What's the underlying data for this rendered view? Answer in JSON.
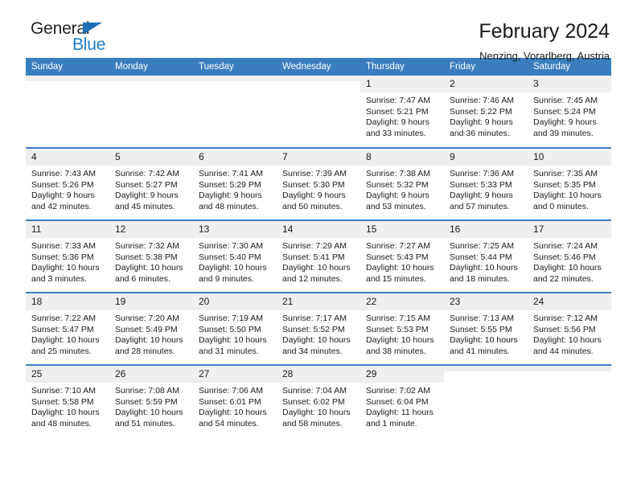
{
  "brand": {
    "word_top": "General",
    "word_bottom": "Blue",
    "triangle_color": "#1f6eb5",
    "blue_color": "#1f7bc4"
  },
  "header": {
    "title": "February 2024",
    "subtitle": "Nenzing, Vorarlberg, Austria"
  },
  "theme": {
    "header_bg": "#3a7ebf",
    "daynum_bg": "#efefef",
    "text": "#1a1a1a"
  },
  "weekday_headers": [
    "Sunday",
    "Monday",
    "Tuesday",
    "Wednesday",
    "Thursday",
    "Friday",
    "Saturday"
  ],
  "weeks": [
    [
      {
        "day": "",
        "lines": []
      },
      {
        "day": "",
        "lines": []
      },
      {
        "day": "",
        "lines": []
      },
      {
        "day": "",
        "lines": []
      },
      {
        "day": "1",
        "lines": [
          "Sunrise: 7:47 AM",
          "Sunset: 5:21 PM",
          "Daylight: 9 hours",
          "and 33 minutes."
        ]
      },
      {
        "day": "2",
        "lines": [
          "Sunrise: 7:46 AM",
          "Sunset: 5:22 PM",
          "Daylight: 9 hours",
          "and 36 minutes."
        ]
      },
      {
        "day": "3",
        "lines": [
          "Sunrise: 7:45 AM",
          "Sunset: 5:24 PM",
          "Daylight: 9 hours",
          "and 39 minutes."
        ]
      }
    ],
    [
      {
        "day": "4",
        "lines": [
          "Sunrise: 7:43 AM",
          "Sunset: 5:26 PM",
          "Daylight: 9 hours",
          "and 42 minutes."
        ]
      },
      {
        "day": "5",
        "lines": [
          "Sunrise: 7:42 AM",
          "Sunset: 5:27 PM",
          "Daylight: 9 hours",
          "and 45 minutes."
        ]
      },
      {
        "day": "6",
        "lines": [
          "Sunrise: 7:41 AM",
          "Sunset: 5:29 PM",
          "Daylight: 9 hours",
          "and 48 minutes."
        ]
      },
      {
        "day": "7",
        "lines": [
          "Sunrise: 7:39 AM",
          "Sunset: 5:30 PM",
          "Daylight: 9 hours",
          "and 50 minutes."
        ]
      },
      {
        "day": "8",
        "lines": [
          "Sunrise: 7:38 AM",
          "Sunset: 5:32 PM",
          "Daylight: 9 hours",
          "and 53 minutes."
        ]
      },
      {
        "day": "9",
        "lines": [
          "Sunrise: 7:36 AM",
          "Sunset: 5:33 PM",
          "Daylight: 9 hours",
          "and 57 minutes."
        ]
      },
      {
        "day": "10",
        "lines": [
          "Sunrise: 7:35 AM",
          "Sunset: 5:35 PM",
          "Daylight: 10 hours",
          "and 0 minutes."
        ]
      }
    ],
    [
      {
        "day": "11",
        "lines": [
          "Sunrise: 7:33 AM",
          "Sunset: 5:36 PM",
          "Daylight: 10 hours",
          "and 3 minutes."
        ]
      },
      {
        "day": "12",
        "lines": [
          "Sunrise: 7:32 AM",
          "Sunset: 5:38 PM",
          "Daylight: 10 hours",
          "and 6 minutes."
        ]
      },
      {
        "day": "13",
        "lines": [
          "Sunrise: 7:30 AM",
          "Sunset: 5:40 PM",
          "Daylight: 10 hours",
          "and 9 minutes."
        ]
      },
      {
        "day": "14",
        "lines": [
          "Sunrise: 7:29 AM",
          "Sunset: 5:41 PM",
          "Daylight: 10 hours",
          "and 12 minutes."
        ]
      },
      {
        "day": "15",
        "lines": [
          "Sunrise: 7:27 AM",
          "Sunset: 5:43 PM",
          "Daylight: 10 hours",
          "and 15 minutes."
        ]
      },
      {
        "day": "16",
        "lines": [
          "Sunrise: 7:25 AM",
          "Sunset: 5:44 PM",
          "Daylight: 10 hours",
          "and 18 minutes."
        ]
      },
      {
        "day": "17",
        "lines": [
          "Sunrise: 7:24 AM",
          "Sunset: 5:46 PM",
          "Daylight: 10 hours",
          "and 22 minutes."
        ]
      }
    ],
    [
      {
        "day": "18",
        "lines": [
          "Sunrise: 7:22 AM",
          "Sunset: 5:47 PM",
          "Daylight: 10 hours",
          "and 25 minutes."
        ]
      },
      {
        "day": "19",
        "lines": [
          "Sunrise: 7:20 AM",
          "Sunset: 5:49 PM",
          "Daylight: 10 hours",
          "and 28 minutes."
        ]
      },
      {
        "day": "20",
        "lines": [
          "Sunrise: 7:19 AM",
          "Sunset: 5:50 PM",
          "Daylight: 10 hours",
          "and 31 minutes."
        ]
      },
      {
        "day": "21",
        "lines": [
          "Sunrise: 7:17 AM",
          "Sunset: 5:52 PM",
          "Daylight: 10 hours",
          "and 34 minutes."
        ]
      },
      {
        "day": "22",
        "lines": [
          "Sunrise: 7:15 AM",
          "Sunset: 5:53 PM",
          "Daylight: 10 hours",
          "and 38 minutes."
        ]
      },
      {
        "day": "23",
        "lines": [
          "Sunrise: 7:13 AM",
          "Sunset: 5:55 PM",
          "Daylight: 10 hours",
          "and 41 minutes."
        ]
      },
      {
        "day": "24",
        "lines": [
          "Sunrise: 7:12 AM",
          "Sunset: 5:56 PM",
          "Daylight: 10 hours",
          "and 44 minutes."
        ]
      }
    ],
    [
      {
        "day": "25",
        "lines": [
          "Sunrise: 7:10 AM",
          "Sunset: 5:58 PM",
          "Daylight: 10 hours",
          "and 48 minutes."
        ]
      },
      {
        "day": "26",
        "lines": [
          "Sunrise: 7:08 AM",
          "Sunset: 5:59 PM",
          "Daylight: 10 hours",
          "and 51 minutes."
        ]
      },
      {
        "day": "27",
        "lines": [
          "Sunrise: 7:06 AM",
          "Sunset: 6:01 PM",
          "Daylight: 10 hours",
          "and 54 minutes."
        ]
      },
      {
        "day": "28",
        "lines": [
          "Sunrise: 7:04 AM",
          "Sunset: 6:02 PM",
          "Daylight: 10 hours",
          "and 58 minutes."
        ]
      },
      {
        "day": "29",
        "lines": [
          "Sunrise: 7:02 AM",
          "Sunset: 6:04 PM",
          "Daylight: 11 hours",
          "and 1 minute."
        ]
      },
      {
        "day": "",
        "lines": []
      },
      {
        "day": "",
        "lines": []
      }
    ]
  ]
}
